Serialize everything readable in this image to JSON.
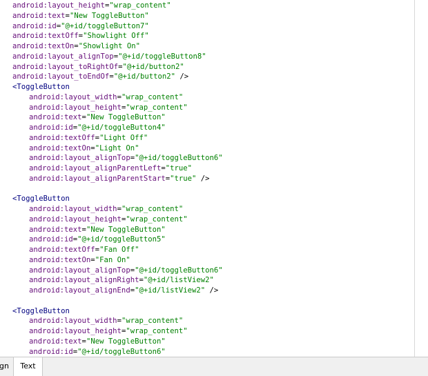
{
  "editor": {
    "lines": [
      {
        "indent": 0,
        "kind": "attr",
        "attr": "android:layout_height",
        "value": "\"wrap_content\"",
        "suffix": ""
      },
      {
        "indent": 0,
        "kind": "attr",
        "attr": "android:text",
        "value": "\"New ToggleButton\"",
        "suffix": ""
      },
      {
        "indent": 0,
        "kind": "attr",
        "attr": "android:id",
        "value": "\"@+id/toggleButton7\"",
        "suffix": ""
      },
      {
        "indent": 0,
        "kind": "attr",
        "attr": "android:textOff",
        "value": "\"Showlight Off\"",
        "suffix": ""
      },
      {
        "indent": 0,
        "kind": "attr",
        "attr": "android:textOn",
        "value": "\"Showlight On\"",
        "suffix": ""
      },
      {
        "indent": 0,
        "kind": "attr",
        "attr": "android:layout_alignTop",
        "value": "\"@+id/toggleButton8\"",
        "suffix": ""
      },
      {
        "indent": 0,
        "kind": "attr",
        "attr": "android:layout_toRightOf",
        "value": "\"@+id/button2\"",
        "suffix": ""
      },
      {
        "indent": 0,
        "kind": "attr",
        "attr": "android:layout_toEndOf",
        "value": "\"@+id/button2\"",
        "suffix": " />"
      },
      {
        "indent": 0,
        "kind": "tag",
        "text": "<ToggleButton"
      },
      {
        "indent": 1,
        "kind": "attr",
        "attr": "android:layout_width",
        "value": "\"wrap_content\"",
        "suffix": ""
      },
      {
        "indent": 1,
        "kind": "attr",
        "attr": "android:layout_height",
        "value": "\"wrap_content\"",
        "suffix": ""
      },
      {
        "indent": 1,
        "kind": "attr",
        "attr": "android:text",
        "value": "\"New ToggleButton\"",
        "suffix": ""
      },
      {
        "indent": 1,
        "kind": "attr",
        "attr": "android:id",
        "value": "\"@+id/toggleButton4\"",
        "suffix": ""
      },
      {
        "indent": 1,
        "kind": "attr",
        "attr": "android:textOff",
        "value": "\"Light Off\"",
        "suffix": ""
      },
      {
        "indent": 1,
        "kind": "attr",
        "attr": "android:textOn",
        "value": "\"Light On\"",
        "suffix": ""
      },
      {
        "indent": 1,
        "kind": "attr",
        "attr": "android:layout_alignTop",
        "value": "\"@+id/toggleButton6\"",
        "suffix": ""
      },
      {
        "indent": 1,
        "kind": "attr",
        "attr": "android:layout_alignParentLeft",
        "value": "\"true\"",
        "suffix": ""
      },
      {
        "indent": 1,
        "kind": "attr",
        "attr": "android:layout_alignParentStart",
        "value": "\"true\"",
        "suffix": " />"
      },
      {
        "indent": 0,
        "kind": "blank"
      },
      {
        "indent": 0,
        "kind": "tag",
        "text": "<ToggleButton"
      },
      {
        "indent": 1,
        "kind": "attr",
        "attr": "android:layout_width",
        "value": "\"wrap_content\"",
        "suffix": ""
      },
      {
        "indent": 1,
        "kind": "attr",
        "attr": "android:layout_height",
        "value": "\"wrap_content\"",
        "suffix": ""
      },
      {
        "indent": 1,
        "kind": "attr",
        "attr": "android:text",
        "value": "\"New ToggleButton\"",
        "suffix": ""
      },
      {
        "indent": 1,
        "kind": "attr",
        "attr": "android:id",
        "value": "\"@+id/toggleButton5\"",
        "suffix": ""
      },
      {
        "indent": 1,
        "kind": "attr",
        "attr": "android:textOff",
        "value": "\"Fan Off\"",
        "suffix": ""
      },
      {
        "indent": 1,
        "kind": "attr",
        "attr": "android:textOn",
        "value": "\"Fan On\"",
        "suffix": ""
      },
      {
        "indent": 1,
        "kind": "attr",
        "attr": "android:layout_alignTop",
        "value": "\"@+id/toggleButton6\"",
        "suffix": ""
      },
      {
        "indent": 1,
        "kind": "attr",
        "attr": "android:layout_alignRight",
        "value": "\"@+id/listView2\"",
        "suffix": ""
      },
      {
        "indent": 1,
        "kind": "attr",
        "attr": "android:layout_alignEnd",
        "value": "\"@+id/listView2\"",
        "suffix": " />"
      },
      {
        "indent": 0,
        "kind": "blank"
      },
      {
        "indent": 0,
        "kind": "tag",
        "text": "<ToggleButton"
      },
      {
        "indent": 1,
        "kind": "attr",
        "attr": "android:layout_width",
        "value": "\"wrap_content\"",
        "suffix": ""
      },
      {
        "indent": 1,
        "kind": "attr",
        "attr": "android:layout_height",
        "value": "\"wrap_content\"",
        "suffix": ""
      },
      {
        "indent": 1,
        "kind": "attr",
        "attr": "android:text",
        "value": "\"New ToggleButton\"",
        "suffix": ""
      },
      {
        "indent": 1,
        "kind": "attr",
        "attr": "android:id",
        "value": "\"@+id/toggleButton6\"",
        "suffix": ""
      }
    ]
  },
  "tabs": {
    "design_label": "gn",
    "text_label": "Text"
  },
  "colors": {
    "attr": "#660e7a",
    "value": "#008000",
    "tag": "#000080"
  }
}
